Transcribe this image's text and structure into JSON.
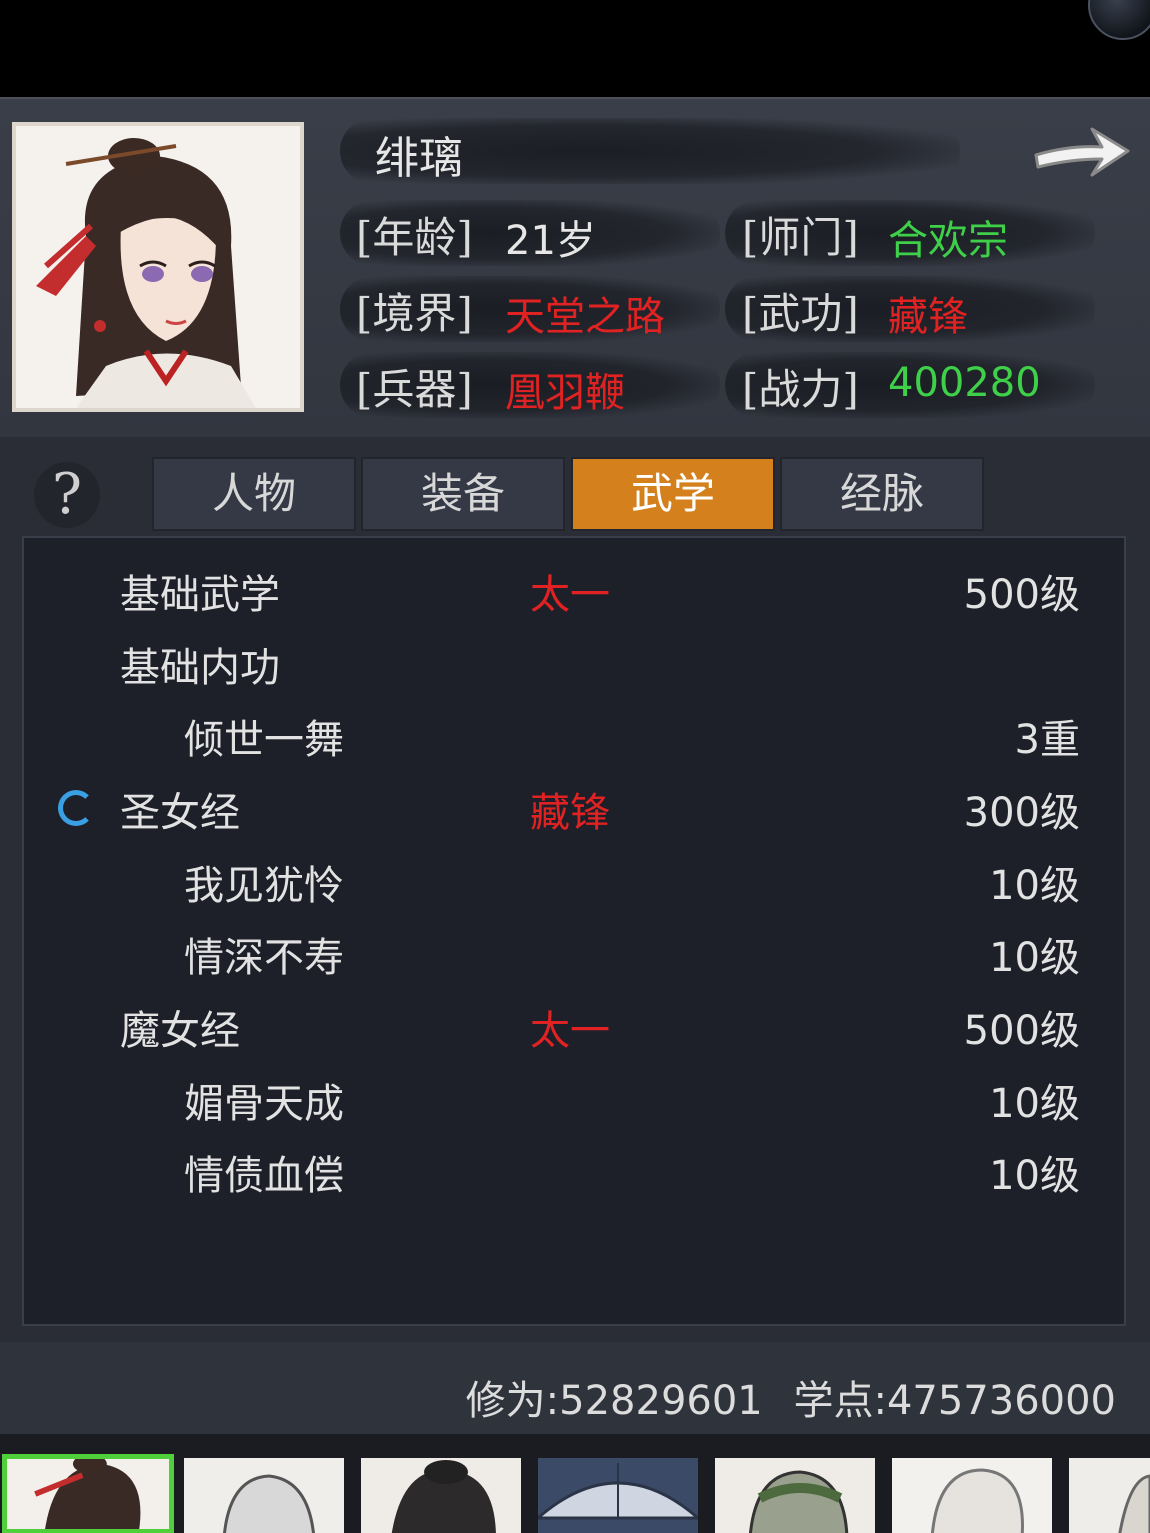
{
  "character": {
    "name": "绯璃",
    "age_label": "[年龄]",
    "age_value": "21岁",
    "sect_label": "[师门]",
    "sect_value": "合欢宗",
    "realm_label": "[境界]",
    "realm_value": "天堂之路",
    "martial_label": "[武功]",
    "martial_value": "藏锋",
    "weapon_label": "[兵器]",
    "weapon_value": "凰羽鞭",
    "power_label": "[战力]",
    "power_value": "400280"
  },
  "help_label": "?",
  "tabs": [
    {
      "label": "人物",
      "active": false
    },
    {
      "label": "装备",
      "active": false
    },
    {
      "label": "武学",
      "active": true
    },
    {
      "label": "经脉",
      "active": false
    }
  ],
  "skills": [
    {
      "name": "基础武学",
      "tag": "太一",
      "level": "500级",
      "indent": false
    },
    {
      "name": "基础内功",
      "tag": "",
      "level": "",
      "indent": false
    },
    {
      "name": "倾世一舞",
      "tag": "",
      "level": "3重",
      "indent": true
    },
    {
      "name": "圣女经",
      "tag": "藏锋",
      "level": "300级",
      "indent": false,
      "active": true
    },
    {
      "name": "我见犹怜",
      "tag": "",
      "level": "10级",
      "indent": true
    },
    {
      "name": "情深不寿",
      "tag": "",
      "level": "10级",
      "indent": true
    },
    {
      "name": "魔女经",
      "tag": "太一",
      "level": "500级",
      "indent": false
    },
    {
      "name": "媚骨天成",
      "tag": "",
      "level": "10级",
      "indent": true
    },
    {
      "name": "情债血偿",
      "tag": "",
      "level": "10级",
      "indent": true
    }
  ],
  "stats": {
    "cultivation": "修为:52829601",
    "study_points": "学点:475736000"
  },
  "colors": {
    "accent_tab": "#d4801c",
    "red_value": "#e02222",
    "green_value": "#3fd04a",
    "selected_border": "#4fd03a",
    "spinner": "#3aa0e6"
  }
}
